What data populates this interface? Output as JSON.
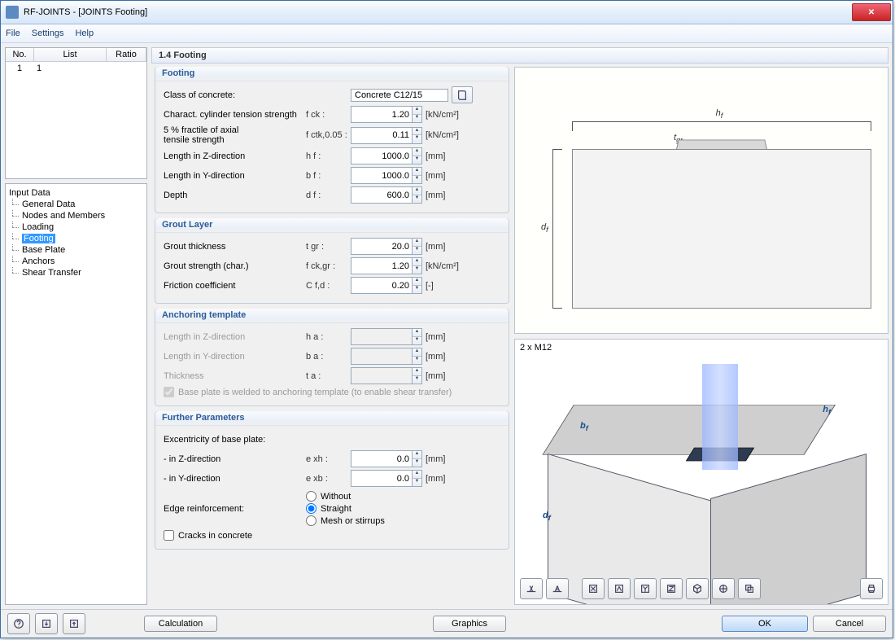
{
  "title": "RF-JOINTS - [JOINTS Footing]",
  "menu": [
    "File",
    "Settings",
    "Help"
  ],
  "list": {
    "headers": [
      "No.",
      "List",
      "Ratio"
    ],
    "rows": [
      {
        "no": "1",
        "list": "1",
        "ratio": ""
      }
    ]
  },
  "tree": {
    "title": "Input Data",
    "items": [
      "General Data",
      "Nodes and Members",
      "Loading",
      "Footing",
      "Base Plate",
      "Anchors",
      "Shear Transfer"
    ],
    "selected": "Footing"
  },
  "section": "1.4 Footing",
  "groups": {
    "footing": {
      "title": "Footing",
      "concrete_lbl": "Class of concrete:",
      "concrete_val": "Concrete C12/15",
      "fck_lbl": "Charact. cylinder tension strength",
      "fck_sym": "f ck :",
      "fck_val": "1.20",
      "fck_unit": "[kN/cm²]",
      "fctk_lbl1": "5 % fractile of axial",
      "fctk_lbl2": "tensile strength",
      "fctk_sym": "f ctk,0.05 :",
      "fctk_val": "0.11",
      "fctk_unit": "[kN/cm²]",
      "hz_lbl": "Length in Z-direction",
      "hz_sym": "h f :",
      "hz_val": "1000.0",
      "hz_unit": "[mm]",
      "by_lbl": "Length in Y-direction",
      "by_sym": "b f :",
      "by_val": "1000.0",
      "by_unit": "[mm]",
      "df_lbl": "Depth",
      "df_sym": "d f :",
      "df_val": "600.0",
      "df_unit": "[mm]"
    },
    "grout": {
      "title": "Grout Layer",
      "t_lbl": "Grout thickness",
      "t_sym": "t gr :",
      "t_val": "20.0",
      "t_unit": "[mm]",
      "f_lbl": "Grout strength (char.)",
      "f_sym": "f ck,gr :",
      "f_val": "1.20",
      "f_unit": "[kN/cm²]",
      "c_lbl": "Friction coefficient",
      "c_sym": "C f,d :",
      "c_val": "0.20",
      "c_unit": "[-]"
    },
    "anchor": {
      "title": "Anchoring template",
      "hz_lbl": "Length in Z-direction",
      "hz_sym": "h a :",
      "hz_unit": "[mm]",
      "by_lbl": "Length in Y-direction",
      "by_sym": "b a :",
      "by_unit": "[mm]",
      "t_lbl": "Thickness",
      "t_sym": "t a :",
      "t_unit": "[mm]",
      "weld": "Base plate is welded to anchoring template (to enable shear transfer)"
    },
    "further": {
      "title": "Further Parameters",
      "ecc_lbl": "Excentricity of base plate:",
      "ez_lbl": "- in Z-direction",
      "ez_sym": "e xh :",
      "ez_val": "0.0",
      "ez_unit": "[mm]",
      "ey_lbl": "- in Y-direction",
      "ey_sym": "e xb :",
      "ey_val": "0.0",
      "ey_unit": "[mm]",
      "edge_lbl": "Edge reinforcement:",
      "r1": "Without",
      "r2": "Straight",
      "r3": "Mesh or stirrups",
      "cracks": "Cracks in concrete"
    }
  },
  "graphics": {
    "hf": "h",
    "df": "d",
    "tgr": "t",
    "bf": "b",
    "f_sub": "f",
    "gr_sub": "gr",
    "bolt_label": "2 x M12"
  },
  "buttons": {
    "calc": "Calculation",
    "graphics": "Graphics",
    "ok": "OK",
    "cancel": "Cancel"
  },
  "toolbar_icons": [
    "axis-x-icon",
    "axis-a-icon",
    "view-x-icon",
    "view-xi-icon",
    "view-yi-icon",
    "view-zi-icon",
    "iso-icon",
    "wireframe-icon",
    "copy-icon",
    "print-icon"
  ]
}
